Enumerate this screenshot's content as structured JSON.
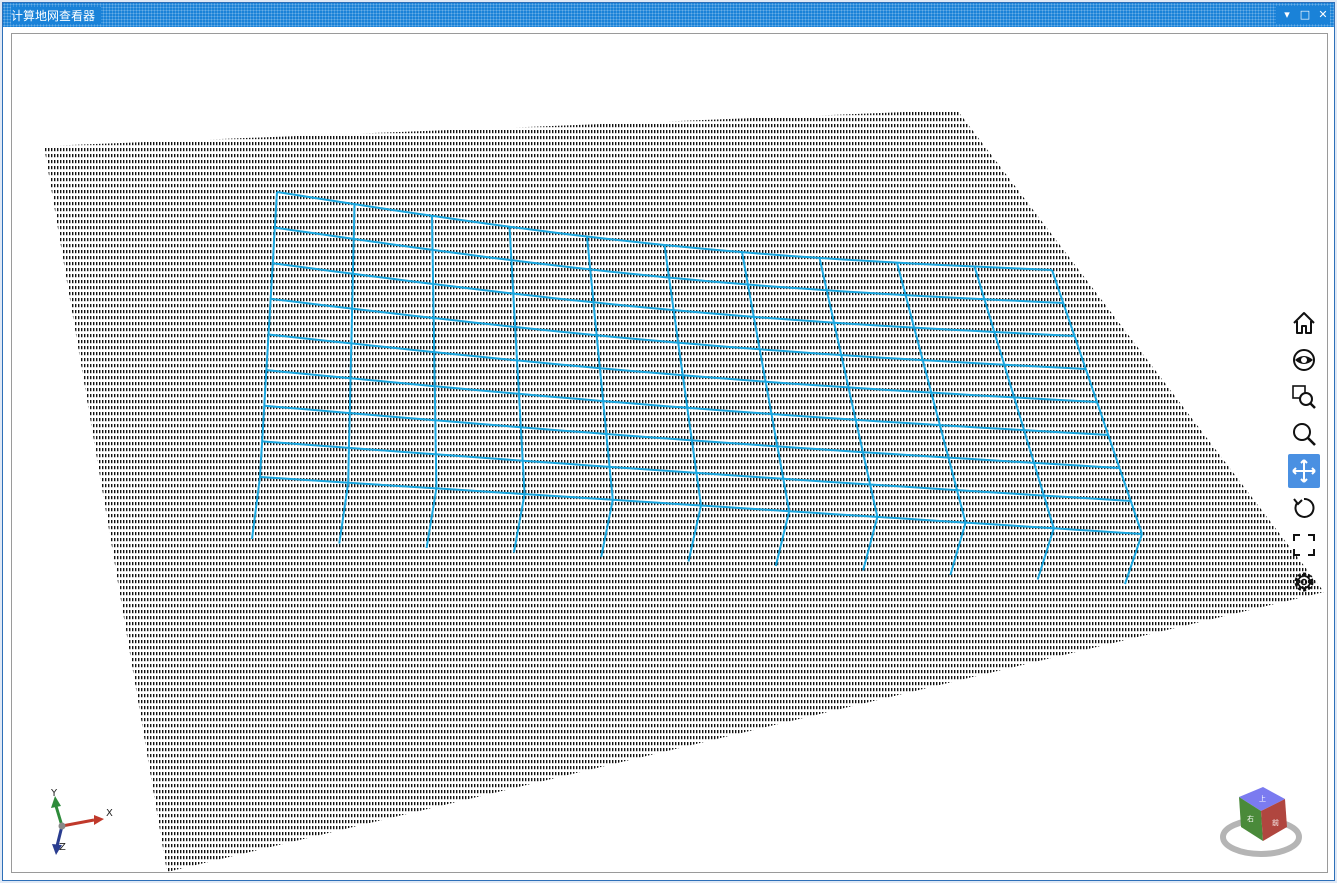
{
  "window": {
    "title": "计算地网查看器",
    "buttons": [
      {
        "name": "dropdown",
        "glyph": "▾"
      },
      {
        "name": "maximize",
        "glyph": "□"
      },
      {
        "name": "close",
        "glyph": "✕"
      }
    ]
  },
  "toolbar": {
    "items": [
      {
        "name": "home-view",
        "icon": "home-icon",
        "active": false
      },
      {
        "name": "look-at",
        "icon": "eye-icon",
        "active": false
      },
      {
        "name": "zoom-window",
        "icon": "zoom-window-icon",
        "active": false
      },
      {
        "name": "zoom",
        "icon": "magnifier-icon",
        "active": false
      },
      {
        "name": "pan",
        "icon": "move-icon",
        "active": true
      },
      {
        "name": "rotate",
        "icon": "rotate-icon",
        "active": false
      },
      {
        "name": "fit-all",
        "icon": "fit-extents-icon",
        "active": false
      },
      {
        "name": "settings",
        "icon": "gear-icon",
        "active": false
      }
    ]
  },
  "axis_triad": {
    "x_label": "X",
    "y_label": "Y",
    "z_label": "Z",
    "colors": {
      "x": "#c0392b",
      "y": "#2e8b3a",
      "z": "#2a3d8f"
    }
  },
  "view_cube": {
    "top_label": "上",
    "front_label": "前",
    "side_label": "右",
    "colors": {
      "top": "#7b7bf0",
      "front": "#b0463f",
      "side": "#4a8a3a"
    }
  },
  "colors": {
    "grid_mesh": "#1aa7e0",
    "ground_points": "#111111",
    "title_bar": "#1a82d8"
  }
}
